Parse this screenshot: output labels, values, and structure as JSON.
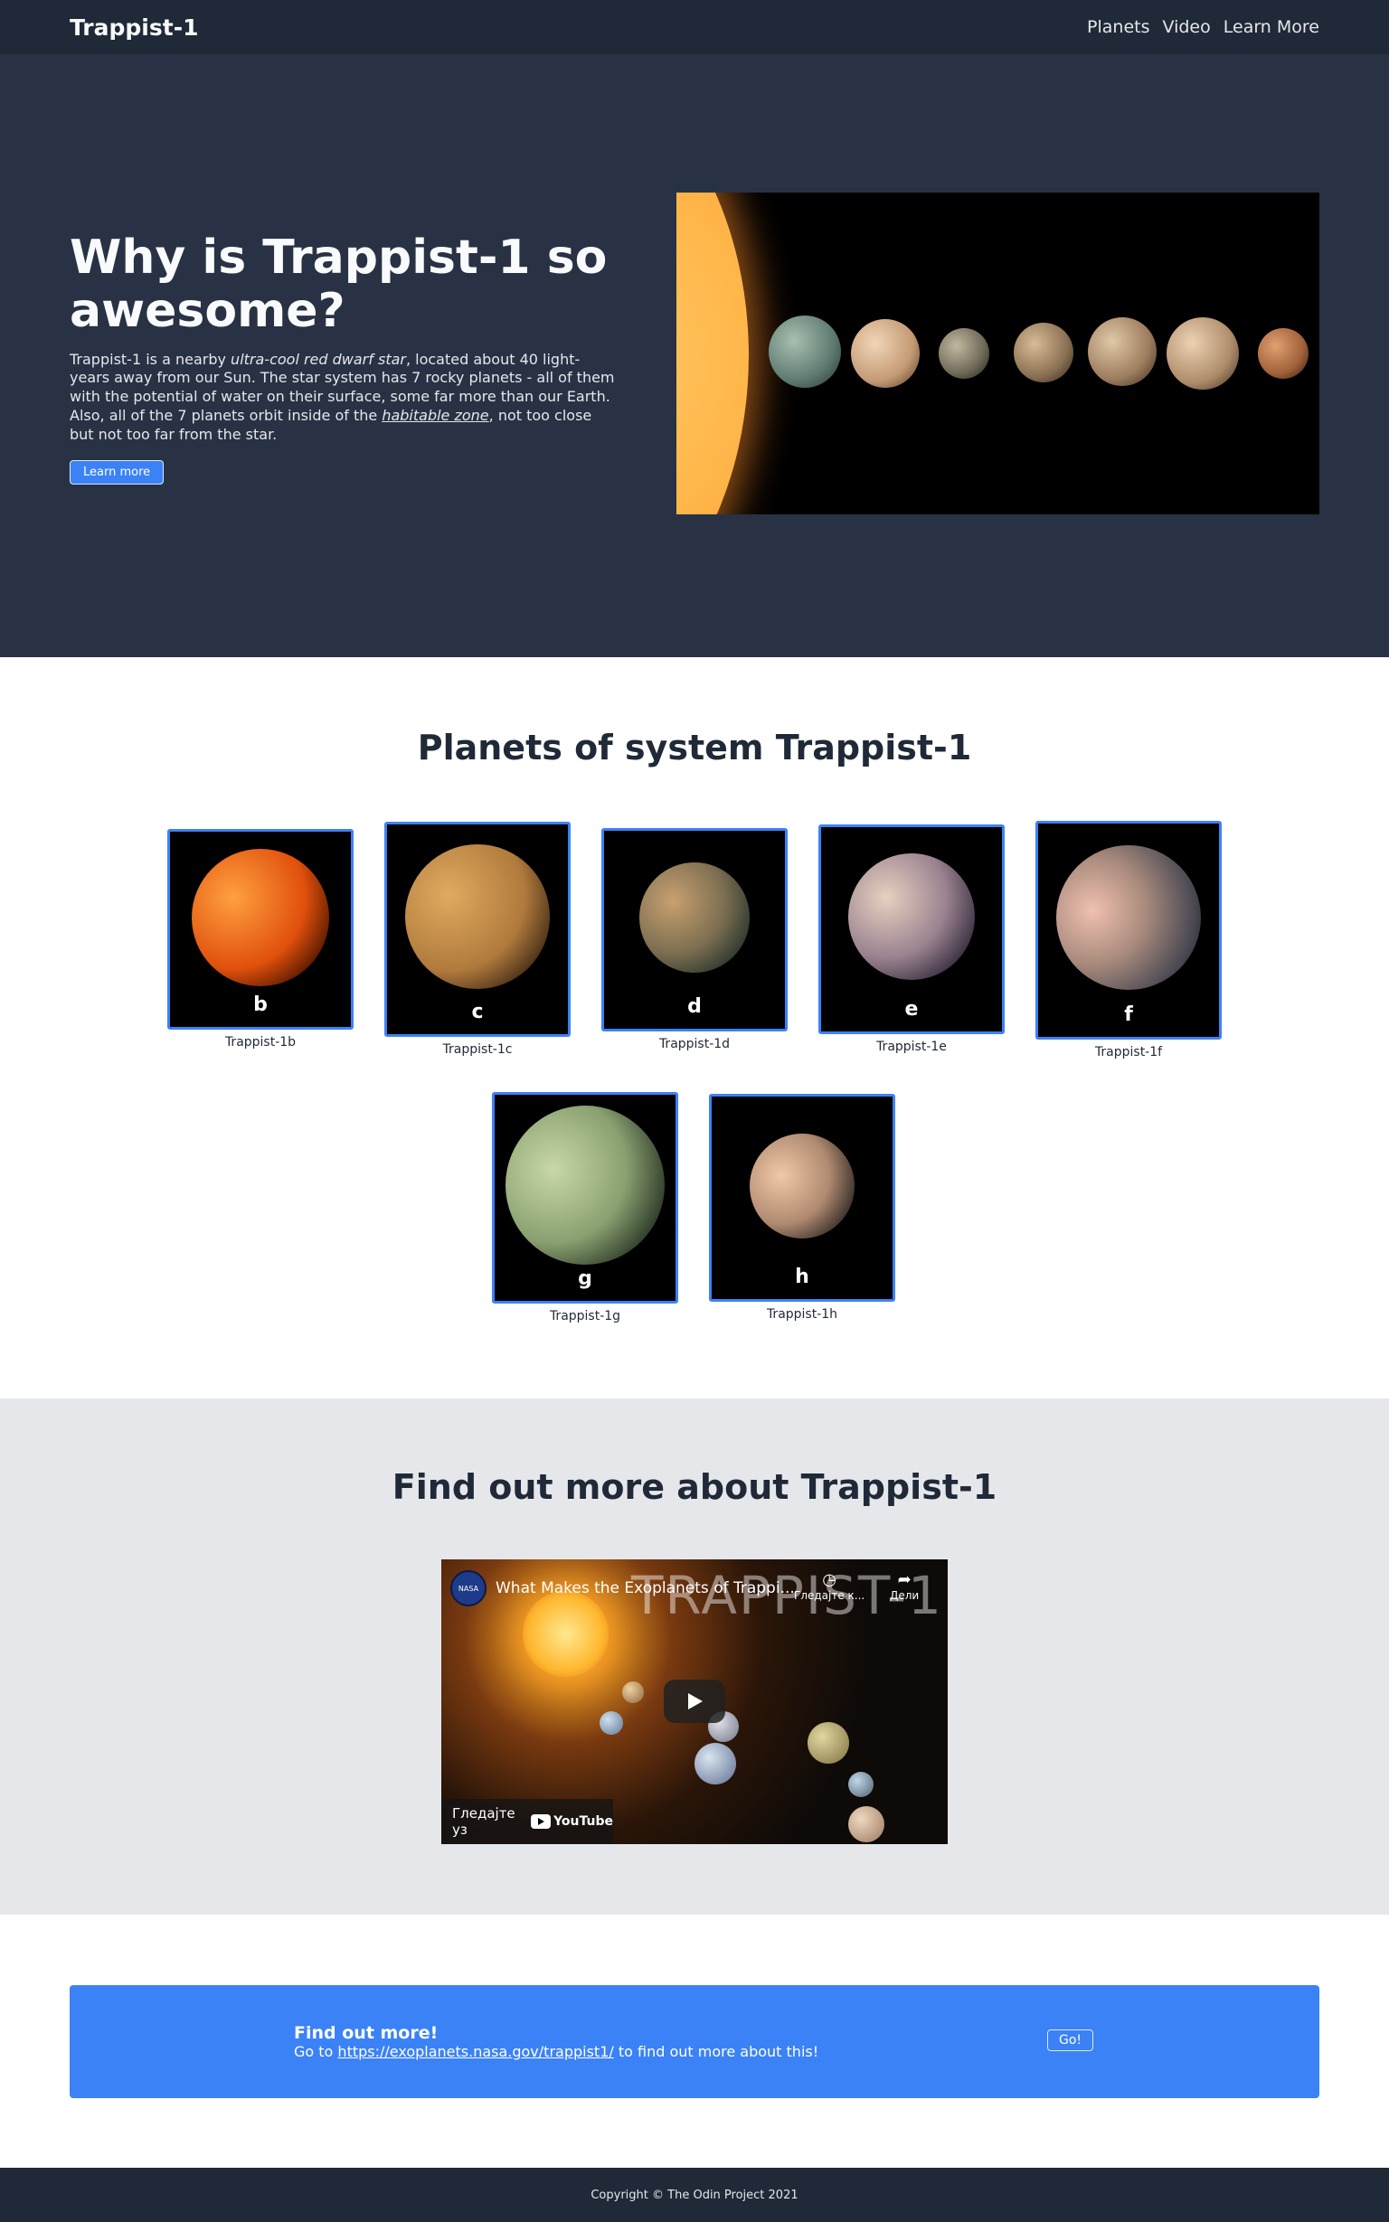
{
  "nav": {
    "brand": "Trappist-1",
    "links": [
      "Planets",
      "Video",
      "Learn More"
    ]
  },
  "hero": {
    "title": "Why is Trappist-1 so awesome?",
    "body_1": "Trappist-1 is a nearby ",
    "body_em": "ultra-cool red dwarf star",
    "body_2": ", located about 40 light-years away from our Sun. The star system has 7 rocky planets - all of them with the potential of water on their surface, some far more than our Earth. Also, all of the 7 planets orbit inside of the ",
    "body_link": "habitable zone",
    "body_3": ", not too close but not too far from the star.",
    "button": "Learn more"
  },
  "planets_section": {
    "title": "Planets of system Trappist-1",
    "planets": [
      {
        "letter": "b",
        "caption": "Trappist-1b"
      },
      {
        "letter": "c",
        "caption": "Trappist-1c"
      },
      {
        "letter": "d",
        "caption": "Trappist-1d"
      },
      {
        "letter": "e",
        "caption": "Trappist-1e"
      },
      {
        "letter": "f",
        "caption": "Trappist-1f"
      },
      {
        "letter": "g",
        "caption": "Trappist-1g"
      },
      {
        "letter": "h",
        "caption": "Trappist-1h"
      }
    ]
  },
  "video_section": {
    "title": "Find out more about Trappist-1",
    "video_title": "What Makes the Exoplanets of Trappi...",
    "overlay_word": "TRAPPIST-1",
    "channel_logo": "NASA",
    "watch_later": "Гледајте к...",
    "share": "Дели",
    "watch_on": "Гледајте уз",
    "youtube": "YouTube"
  },
  "cta": {
    "title": "Find out more!",
    "body_pre": "Go to ",
    "link": "https://exoplanets.nasa.gov/trappist1/",
    "body_post": " to find out more about this!",
    "button": "Go!"
  },
  "footer": {
    "copyright": "Copyright © The Odin Project 2021"
  },
  "colors": {
    "nav_bg": "#1f2937",
    "hero_bg": "#283244",
    "accent": "#3b82f6",
    "video_bg": "#e5e7eb"
  }
}
